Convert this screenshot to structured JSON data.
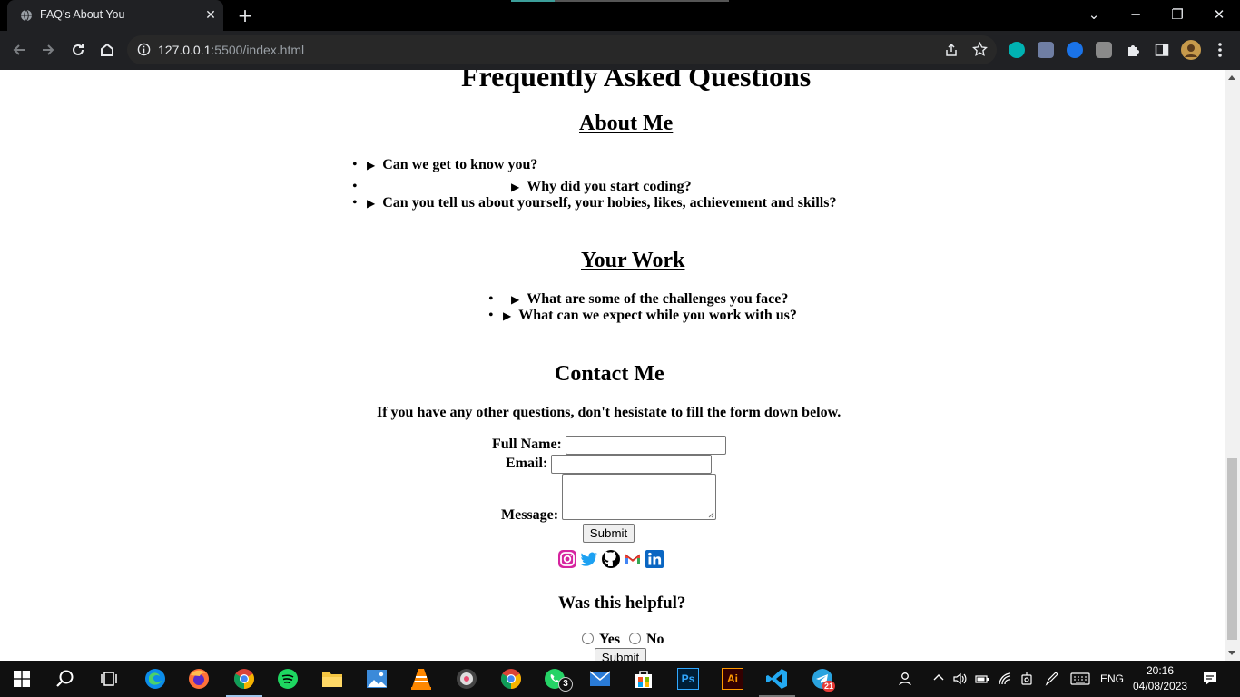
{
  "browser": {
    "tab_title": "FAQ's About You",
    "new_tab_symbol": "+",
    "url_host": "127.0.0.1",
    "url_rest": ":5500/index.html"
  },
  "page": {
    "title": "Frequently Asked Questions",
    "about": {
      "heading": "About Me",
      "questions": [
        "Can we get to know you?",
        "Why did you start coding?",
        "Can you tell us about yourself, your hobies, likes, achievement and skills?"
      ]
    },
    "work": {
      "heading": "Your Work",
      "questions": [
        "What are some of the challenges you face?",
        "What can we expect while you work with us?"
      ]
    },
    "contact": {
      "heading": "Contact Me",
      "intro": "If you have any other questions, don't hesistate to fill the form down below.",
      "full_name_label": "Full Name:",
      "email_label": "Email:",
      "message_label": "Message:",
      "submit_label": "Submit"
    },
    "social_icons": [
      "instagram-icon",
      "twitter-icon",
      "github-icon",
      "gmail-icon",
      "linkedin-icon"
    ],
    "feedback": {
      "question": "Was this helpful?",
      "yes_label": "Yes",
      "no_label": "No",
      "submit_label": "Submit"
    }
  },
  "taskbar": {
    "mail_badge": "3",
    "telegram_badge": "21",
    "language": "ENG",
    "time": "20:16",
    "date": "04/08/2023"
  },
  "colors": {
    "tabstrip": "#000000",
    "toolbar": "#202124",
    "omnibox": "#282828",
    "taskbar": "#101010",
    "instagram": "#d6249f",
    "twitter": "#1da1f2",
    "linkedin": "#0a66c2"
  }
}
